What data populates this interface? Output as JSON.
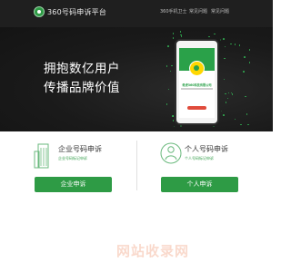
{
  "header": {
    "brand": "360号码申诉平台",
    "nav": [
      "360手机卫士",
      "常见问题",
      "常见问题"
    ]
  },
  "hero": {
    "line1": "拥抱数亿用户",
    "line2": "传播品牌价值"
  },
  "phone": {
    "caller": "奇虎360科技有限公司"
  },
  "cards": [
    {
      "title": "企业号码申诉",
      "desc": "企业号码标记申诉",
      "button": "企业申诉",
      "icon": "building-icon"
    },
    {
      "title": "个人号码申诉",
      "desc": "个人号码标记申诉",
      "button": "个人申诉",
      "icon": "user-icon"
    }
  ],
  "watermark": "网站收录网",
  "colors": {
    "accent": "#2e9b45",
    "dark": "#1f1f1f",
    "watermark": "#ec7a4a"
  }
}
